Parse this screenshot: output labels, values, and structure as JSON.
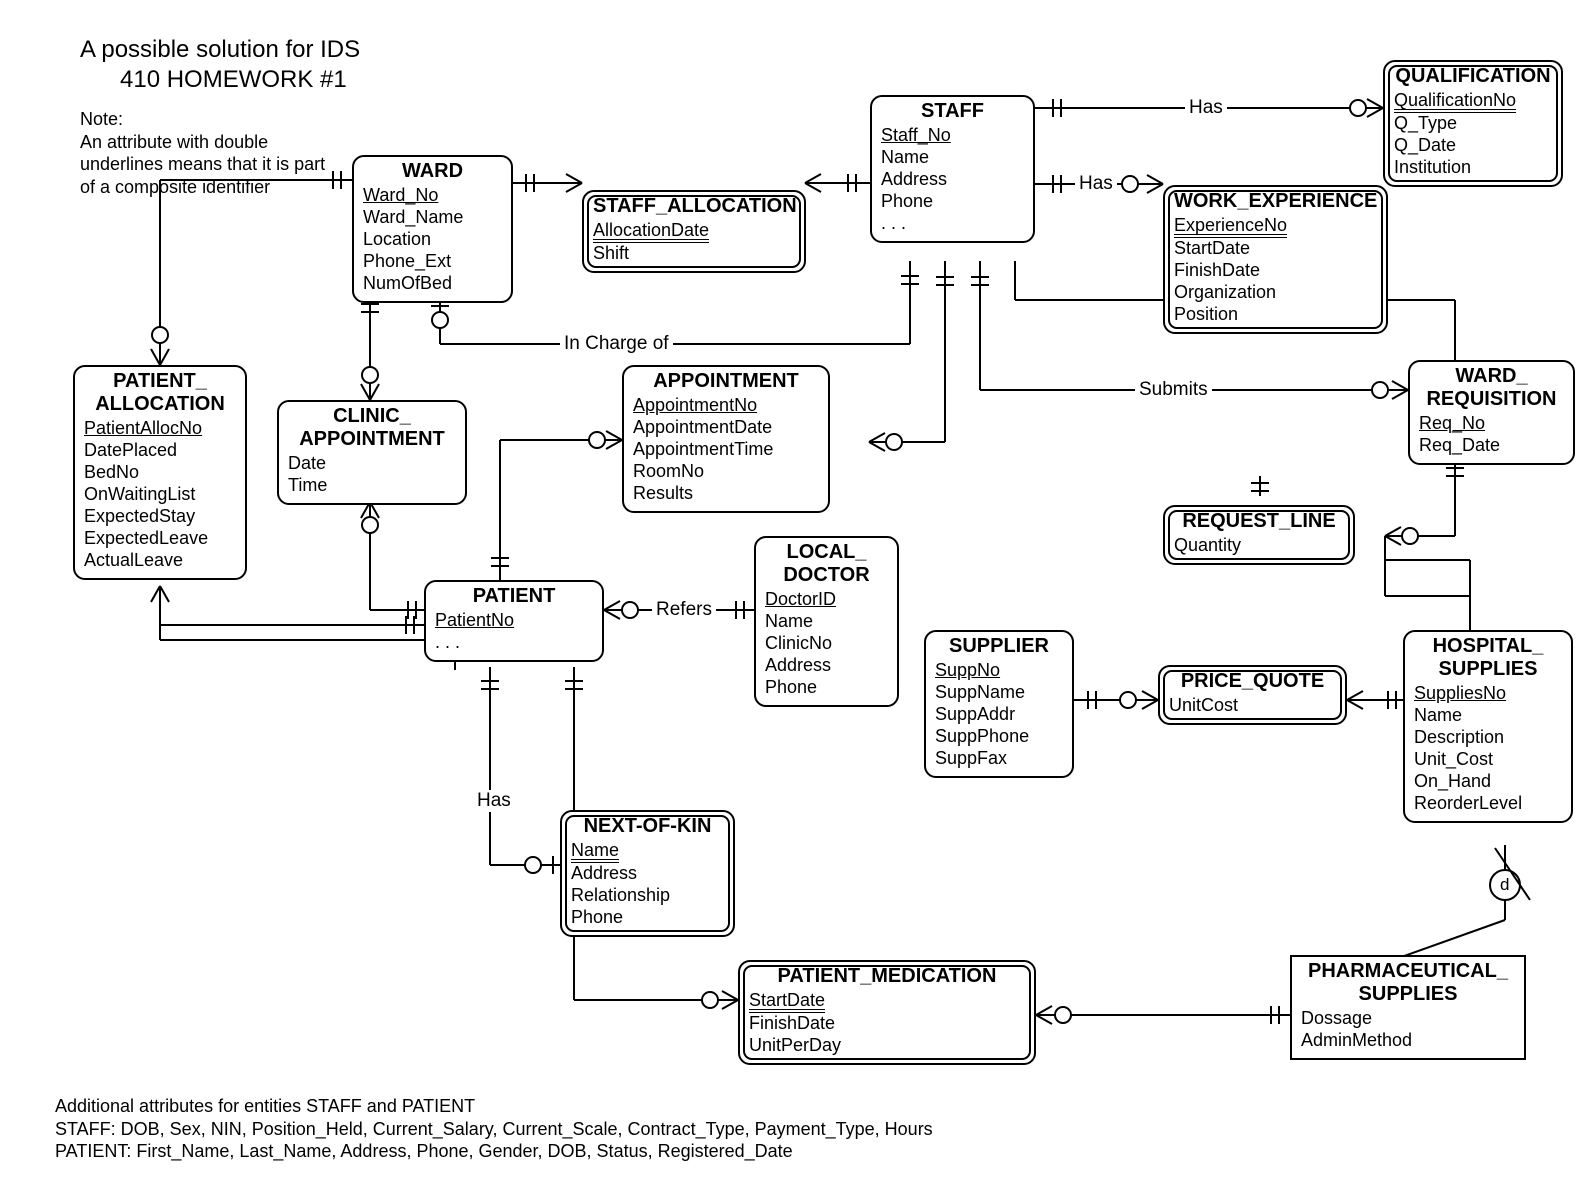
{
  "header": {
    "line1": "A possible solution for IDS",
    "line2": "410 HOMEWORK #1"
  },
  "note": {
    "line1": "Note:",
    "line2": "An attribute with double",
    "line3": "underlines  means that it is part",
    "line4": "of a composite identifier"
  },
  "footer": {
    "line1": "Additional attributes for entities STAFF and PATIENT",
    "line2": "STAFF: DOB, Sex, NIN, Position_Held, Current_Salary, Current_Scale, Contract_Type, Payment_Type, Hours",
    "line3": "PATIENT: First_Name, Last_Name, Address, Phone, Gender, DOB, Status, Registered_Date"
  },
  "relations": {
    "has1": "Has",
    "has2": "Has",
    "has3": "Has",
    "inCharge": "In Charge of",
    "submits": "Submits",
    "refers": "Refers",
    "disjoint": "d"
  },
  "entities": {
    "ward": {
      "title": "WARD",
      "attrs": [
        {
          "t": "Ward_No",
          "k": "pk"
        },
        {
          "t": "Ward_Name"
        },
        {
          "t": "Location"
        },
        {
          "t": "Phone_Ext"
        },
        {
          "t": "NumOfBed"
        }
      ]
    },
    "staff": {
      "title": "STAFF",
      "attrs": [
        {
          "t": "Staff_No",
          "k": "pk"
        },
        {
          "t": "Name"
        },
        {
          "t": "Address"
        },
        {
          "t": "Phone"
        },
        {
          "t": ". . ."
        }
      ]
    },
    "qualification": {
      "title": "QUALIFICATION",
      "attrs": [
        {
          "t": "QualificationNo",
          "k": "partial"
        },
        {
          "t": "Q_Type"
        },
        {
          "t": "Q_Date"
        },
        {
          "t": "Institution"
        }
      ],
      "weak": true
    },
    "workExp": {
      "title": "WORK_EXPERIENCE",
      "attrs": [
        {
          "t": "ExperienceNo",
          "k": "partial"
        },
        {
          "t": "StartDate"
        },
        {
          "t": "FinishDate"
        },
        {
          "t": "Organization"
        },
        {
          "t": "Position"
        }
      ],
      "weak": true
    },
    "staffAlloc": {
      "title": "STAFF_ALLOCATION",
      "attrs": [
        {
          "t": "AllocationDate",
          "k": "partial"
        },
        {
          "t": "Shift"
        }
      ],
      "weak": true
    },
    "patientAlloc": {
      "title": "PATIENT_\nALLOCATION",
      "attrs": [
        {
          "t": "PatientAllocNo",
          "k": "pk"
        },
        {
          "t": "DatePlaced"
        },
        {
          "t": "BedNo"
        },
        {
          "t": "OnWaitingList"
        },
        {
          "t": "ExpectedStay"
        },
        {
          "t": "ExpectedLeave"
        },
        {
          "t": "ActualLeave"
        }
      ]
    },
    "clinicAppt": {
      "title": "CLINIC_\nAPPOINTMENT",
      "attrs": [
        {
          "t": "Date"
        },
        {
          "t": "Time"
        }
      ]
    },
    "appointment": {
      "title": "APPOINTMENT",
      "attrs": [
        {
          "t": "AppointmentNo",
          "k": "pk"
        },
        {
          "t": "AppointmentDate"
        },
        {
          "t": "AppointmentTime"
        },
        {
          "t": "RoomNo"
        },
        {
          "t": "Results"
        }
      ]
    },
    "wardReq": {
      "title": "WARD_\nREQUISITION",
      "attrs": [
        {
          "t": "Req_No",
          "k": "pk"
        },
        {
          "t": "Req_Date"
        }
      ]
    },
    "requestLine": {
      "title": "REQUEST_LINE",
      "attrs": [
        {
          "t": "Quantity"
        }
      ],
      "weak": true
    },
    "patient": {
      "title": "PATIENT",
      "attrs": [
        {
          "t": "PatientNo",
          "k": "pk"
        },
        {
          "t": ". . ."
        }
      ]
    },
    "localDoc": {
      "title": "LOCAL_\nDOCTOR",
      "attrs": [
        {
          "t": "DoctorID",
          "k": "pk"
        },
        {
          "t": "Name"
        },
        {
          "t": "ClinicNo"
        },
        {
          "t": "Address"
        },
        {
          "t": "Phone"
        }
      ]
    },
    "supplier": {
      "title": "SUPPLIER",
      "attrs": [
        {
          "t": "SuppNo",
          "k": "pk"
        },
        {
          "t": "SuppName"
        },
        {
          "t": "SuppAddr"
        },
        {
          "t": "SuppPhone"
        },
        {
          "t": "SuppFax"
        }
      ]
    },
    "priceQuote": {
      "title": "PRICE_QUOTE",
      "attrs": [
        {
          "t": "UnitCost"
        }
      ],
      "weak": true
    },
    "hospSupplies": {
      "title": "HOSPITAL_\nSUPPLIES",
      "attrs": [
        {
          "t": "SuppliesNo",
          "k": "pk"
        },
        {
          "t": "Name"
        },
        {
          "t": "Description"
        },
        {
          "t": "Unit_Cost"
        },
        {
          "t": "On_Hand"
        },
        {
          "t": "ReorderLevel"
        }
      ]
    },
    "nextOfKin": {
      "title": "NEXT-OF-KIN",
      "attrs": [
        {
          "t": "Name",
          "k": "partial"
        },
        {
          "t": "Address"
        },
        {
          "t": "Relationship"
        },
        {
          "t": "Phone"
        }
      ],
      "weak": true
    },
    "patientMed": {
      "title": "PATIENT_MEDICATION",
      "attrs": [
        {
          "t": "StartDate",
          "k": "partial"
        },
        {
          "t": "FinishDate"
        },
        {
          "t": "UnitPerDay"
        }
      ],
      "weak": true
    },
    "pharmSupplies": {
      "title": "PHARMACEUTICAL_\nSUPPLIES",
      "attrs": [
        {
          "t": "Dossage"
        },
        {
          "t": "AdminMethod"
        }
      ]
    }
  }
}
